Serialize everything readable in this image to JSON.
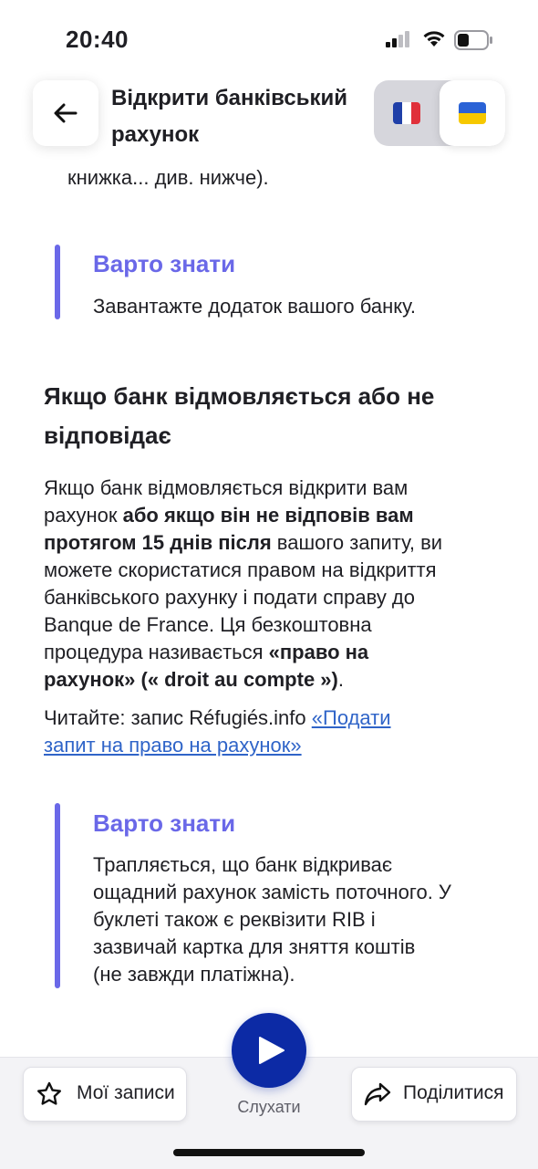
{
  "status_bar": {
    "time": "20:40"
  },
  "header": {
    "title_line1": "Відкрити банківський",
    "title_line2": "рахунок",
    "back_icon": "arrow-left-icon",
    "languages": [
      {
        "code": "fr",
        "flag_colors": [
          "#1f3fa8",
          "#ffffff",
          "#e0303a"
        ],
        "active": false
      },
      {
        "code": "uk",
        "flag_colors": [
          "#2a62d6",
          "#f6c800"
        ],
        "active": true
      }
    ]
  },
  "content": {
    "partial_top_line": "книжка... див. нижче).",
    "callout1": {
      "title": "Варто знати",
      "text": "Завантажте додаток вашого банку."
    },
    "section_heading_line1": "Якщо банк відмовляється або не",
    "section_heading_line2": "відповідає",
    "paragraph": {
      "l1": "Якщо банк відмовляється відкрити вам",
      "l2_a": "рахунок ",
      "l2_b": "або якщо він не відповів вам",
      "l3_a": "протягом 15 днів після",
      "l3_b": " вашого запиту, ви",
      "l4": "можете скористатися правом на відкриття",
      "l5": "банківського рахунку і подати справу до",
      "l6": "Banque de France. Ця безкоштовна",
      "l7_a": "процедура називається ",
      "l7_b": "«право на",
      "l8_a": "рахунок» (« droit au compte »)",
      "l8_b": "."
    },
    "read_more": {
      "prefix": "Читайте: запис Réfugiés.info ",
      "link_line1": "«Подати",
      "link_line2": "запит на право на рахунок»"
    },
    "callout2": {
      "title": "Варто знати",
      "l1": "Трапляється, що банк відкриває",
      "l2": "ощадний рахунок замість поточного. У",
      "l3": "буклеті також є реквізити RIB і",
      "l4": "зазвичай картка для зняття коштів",
      "l5": "(не завжди платіжна)."
    }
  },
  "bottom_bar": {
    "my_records": {
      "label": "Мої записи",
      "icon": "star-icon"
    },
    "listen": {
      "label": "Слухати",
      "icon": "play-icon"
    },
    "share": {
      "label": "Поділитися",
      "icon": "share-icon"
    }
  },
  "colors": {
    "accent": "#6a68e8",
    "play": "#0c2aa5",
    "link": "#2f64c8"
  }
}
